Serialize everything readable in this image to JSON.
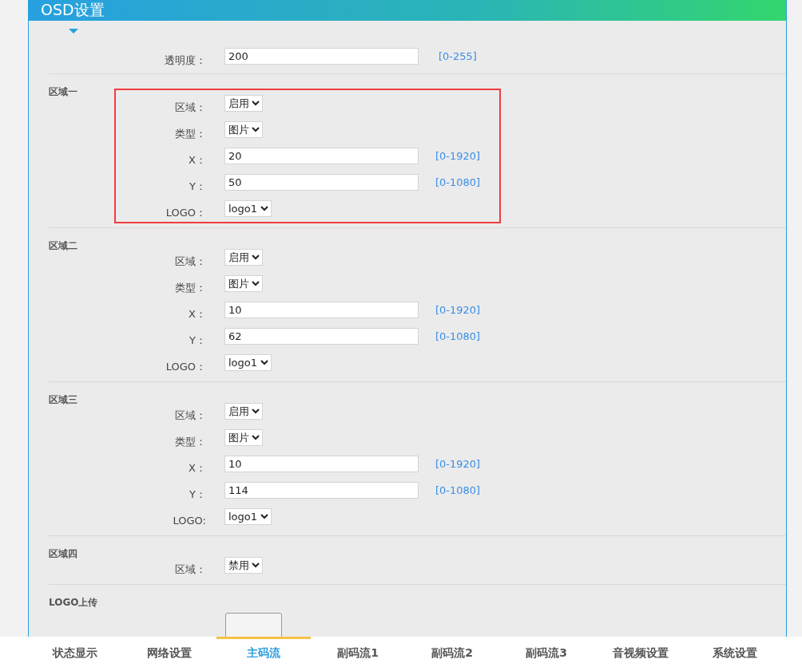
{
  "panel": {
    "title": "OSD设置"
  },
  "transparency": {
    "label": "透明度：",
    "value": "200",
    "range": "[0-255]"
  },
  "regions": [
    {
      "title": "区域一",
      "highlighted": true,
      "fields": [
        {
          "kind": "select",
          "label": "区域：",
          "value": "启用"
        },
        {
          "kind": "select",
          "label": "类型：",
          "value": "图片"
        },
        {
          "kind": "input",
          "label": "X：",
          "value": "20",
          "range": "[0-1920]"
        },
        {
          "kind": "input",
          "label": "Y：",
          "value": "50",
          "range": "[0-1080]"
        },
        {
          "kind": "select",
          "label": "LOGO：",
          "value": "logo1"
        }
      ]
    },
    {
      "title": "区域二",
      "highlighted": false,
      "fields": [
        {
          "kind": "select",
          "label": "区域：",
          "value": "启用"
        },
        {
          "kind": "select",
          "label": "类型：",
          "value": "图片"
        },
        {
          "kind": "input",
          "label": "X：",
          "value": "10",
          "range": "[0-1920]"
        },
        {
          "kind": "input",
          "label": "Y：",
          "value": "62",
          "range": "[0-1080]"
        },
        {
          "kind": "select",
          "label": "LOGO：",
          "value": "logo1"
        }
      ]
    },
    {
      "title": "区域三",
      "highlighted": false,
      "fields": [
        {
          "kind": "select",
          "label": "区域：",
          "value": "启用"
        },
        {
          "kind": "select",
          "label": "类型：",
          "value": "图片"
        },
        {
          "kind": "input",
          "label": "X：",
          "value": "10",
          "range": "[0-1920]"
        },
        {
          "kind": "input",
          "label": "Y：",
          "value": "114",
          "range": "[0-1080]"
        },
        {
          "kind": "select",
          "label": "LOGO:",
          "value": "logo1"
        }
      ]
    },
    {
      "title": "区域四",
      "highlighted": false,
      "fields": [
        {
          "kind": "select",
          "label": "区域：",
          "value": "禁用"
        }
      ]
    }
  ],
  "upload": {
    "title": "LOGO上传"
  },
  "nav": [
    {
      "label": "状态显示",
      "selected": false
    },
    {
      "label": "网络设置",
      "selected": false
    },
    {
      "label": "主码流",
      "selected": true
    },
    {
      "label": "副码流1",
      "selected": false
    },
    {
      "label": "副码流2",
      "selected": false
    },
    {
      "label": "副码流3",
      "selected": false
    },
    {
      "label": "音视频设置",
      "selected": false
    },
    {
      "label": "系统设置",
      "selected": false
    }
  ]
}
